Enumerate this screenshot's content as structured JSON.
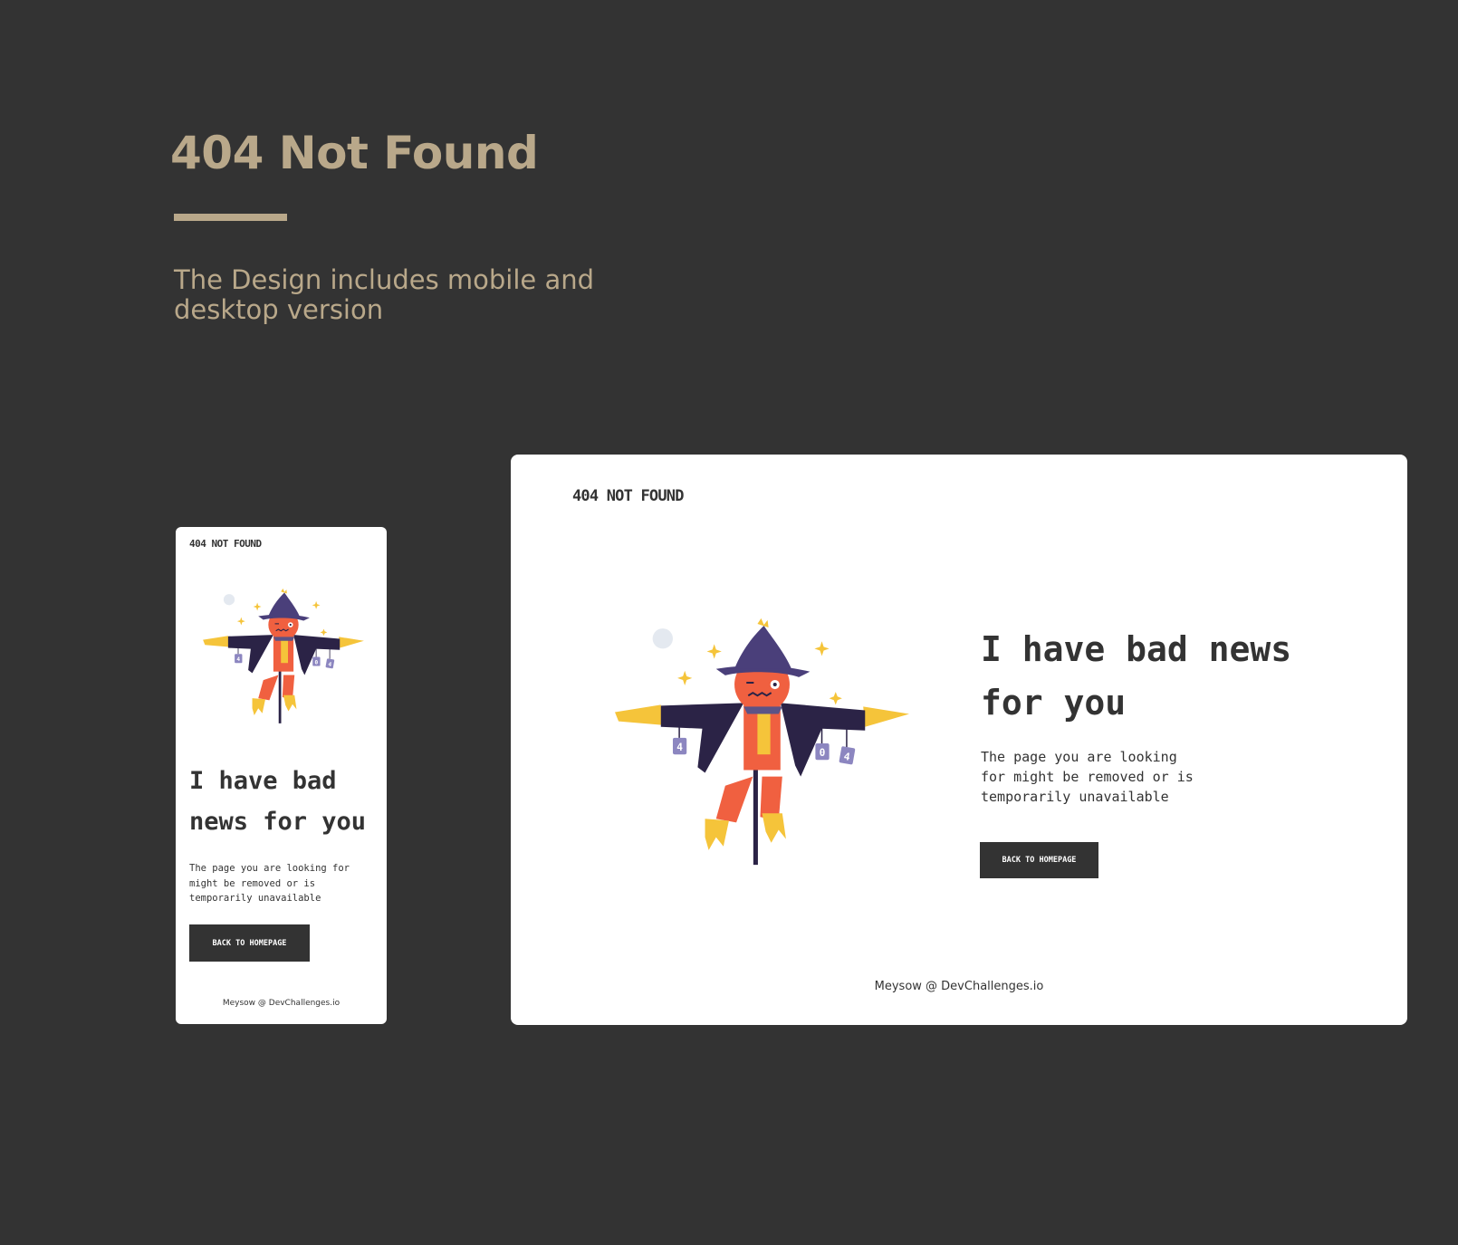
{
  "presentation": {
    "title": "404 Not Found",
    "subtitle": "The Design includes mobile and desktop version"
  },
  "mobile": {
    "brand": "404 NOT FOUND",
    "heading": "I have bad news for you",
    "body": "The page you are looking for might be removed or is temporarily unavailable",
    "button": "BACK TO HOMEPAGE",
    "footer": "Meysow @ DevChallenges.io"
  },
  "desktop": {
    "brand": "404 NOT FOUND",
    "heading": "I have bad news for you",
    "body": "The page you are looking for might be removed or is temporarily unavailable",
    "button": "BACK TO HOMEPAGE",
    "footer": "Meysow @ DevChallenges.io"
  },
  "illustration": {
    "name": "scarecrow",
    "can_labels": [
      "4",
      "0",
      "4"
    ]
  },
  "colors": {
    "background": "#333333",
    "accent": "#B9A88A",
    "card": "#FFFFFF",
    "text": "#333333",
    "hat": "#4A3F7A",
    "coat": "#2B2346",
    "face": "#F06040",
    "straw": "#F5C43A",
    "scarf": "#5C5386"
  }
}
